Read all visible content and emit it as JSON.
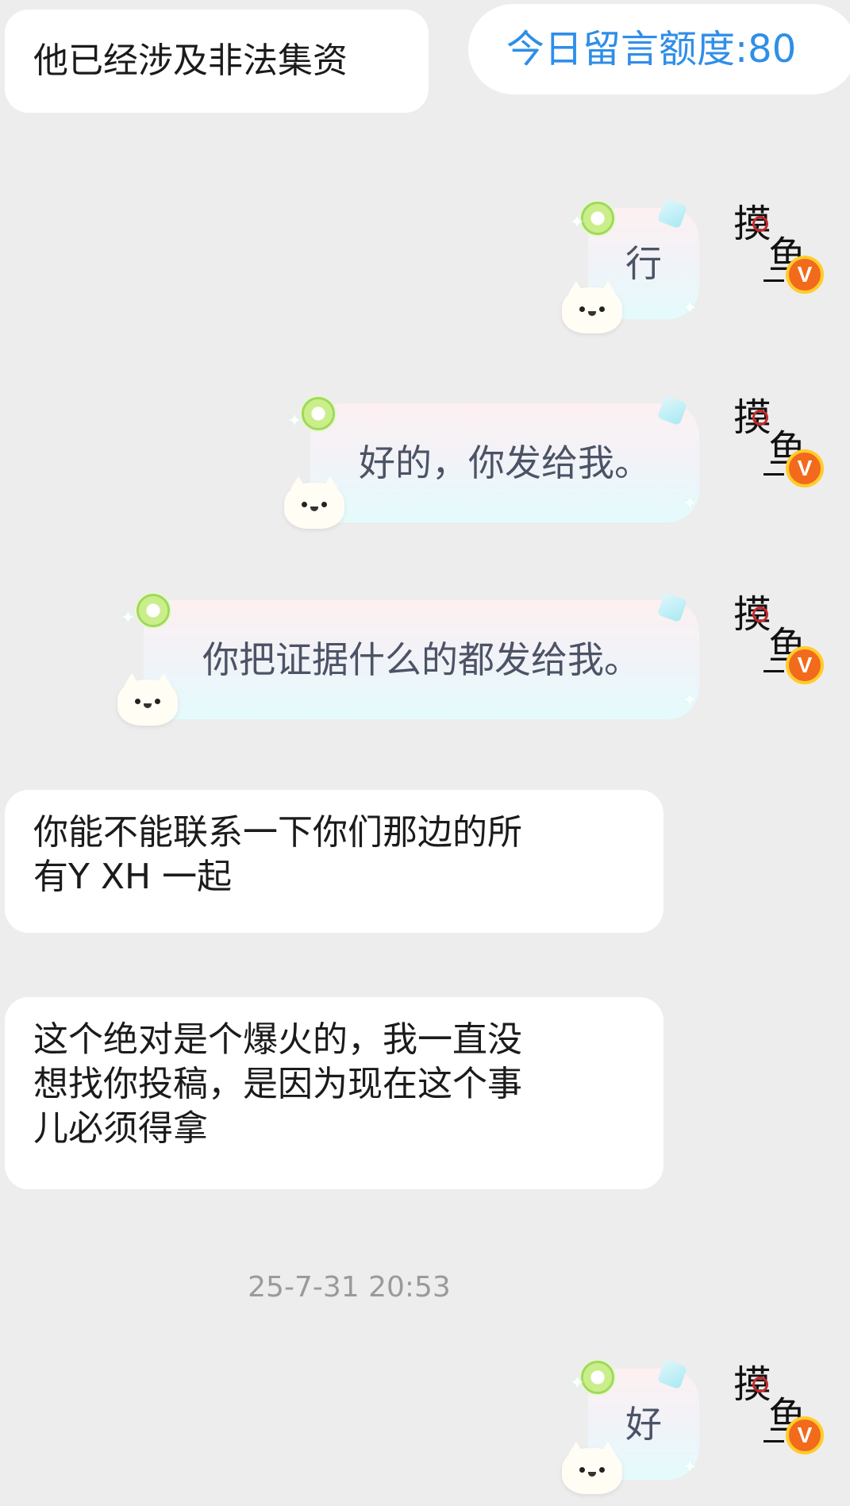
{
  "quota": {
    "label": "今日留言额度:80"
  },
  "messages": [
    {
      "direction": "in",
      "text": "他已经涉及非法集资"
    },
    {
      "direction": "out",
      "text": "行"
    },
    {
      "direction": "out",
      "text": "好的，你发给我。"
    },
    {
      "direction": "out",
      "text": "你把证据什么的都发给我。"
    },
    {
      "direction": "in",
      "text_lines": [
        "你能不能联系一下你们那边的所",
        "有Y XH 一起"
      ]
    },
    {
      "direction": "in",
      "text_lines": [
        "这个绝对是个爆火的，我一直没",
        "想找你投稿，是因为现在这个事",
        "儿必须得拿"
      ]
    },
    {
      "direction": "out",
      "text": "好"
    }
  ],
  "timestamp": "25-7-31 20:53",
  "avatar": {
    "calligraphy": [
      "摸",
      "鱼"
    ],
    "badge": "V"
  },
  "colors": {
    "background": "#ededed",
    "quota_text": "#2f8ee8",
    "badge": "#f26a1b"
  }
}
